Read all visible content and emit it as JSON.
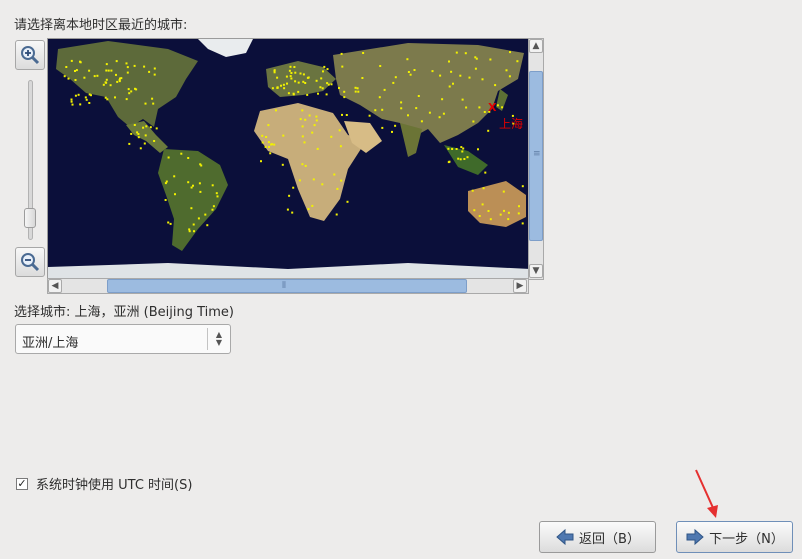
{
  "prompt": "请选择离本地时区最近的城市:",
  "map": {
    "marker_city": "上海",
    "marker_symbol": "X",
    "marker_color": "#e00000",
    "dot_color": "#f2f200",
    "ocean_color": "#0b0f3a"
  },
  "selected_city_line": "选择城市: 上海，亚洲 (Beijing Time)",
  "timezone_select": {
    "value": "亚洲/上海"
  },
  "utc_checkbox": {
    "checked": true,
    "mark": "✓",
    "label": "系统时钟使用 UTC 时间(S)"
  },
  "buttons": {
    "back": "返回（B）",
    "next": "下一步（N）"
  },
  "icons": {
    "zoom_in": "zoom-in-icon",
    "zoom_out": "zoom-out-icon",
    "back": "arrow-left-icon",
    "next": "arrow-right-icon"
  },
  "accent_color": "#9cbbe0"
}
